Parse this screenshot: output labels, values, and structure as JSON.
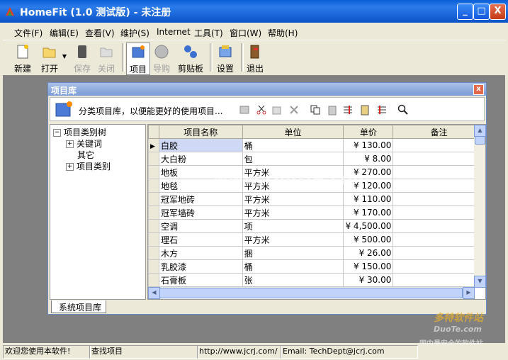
{
  "window": {
    "title": "HomeFit (1.0 测试版) - 未注册",
    "minimize": "_",
    "maximize": "□",
    "close": "X"
  },
  "menu": [
    "文件(F)",
    "编辑(E)",
    "查看(V)",
    "维护(S)",
    "Internet",
    "工具(T)",
    "窗口(W)",
    "帮助(H)"
  ],
  "toolbar": {
    "new": "新建",
    "open": "打开",
    "save": "保存",
    "close": "关闭",
    "item": "项目",
    "guide": "导购",
    "clipboard": "剪贴板",
    "settings": "设置",
    "exit": "退出"
  },
  "panel": {
    "title": "项目库",
    "close": "x",
    "hint": "分类项目库，以便能更好的使用项目...",
    "tab": "系统项目库"
  },
  "tree": {
    "root": "项目类别树",
    "children": [
      "关键词",
      "其它",
      "项目类别"
    ]
  },
  "grid": {
    "columns": [
      "项目名称",
      "单位",
      "单价",
      "备注"
    ],
    "rows": [
      {
        "name": "白胶",
        "unit": "桶",
        "price": "¥ 130.00",
        "note": ""
      },
      {
        "name": "大白粉",
        "unit": "包",
        "price": "¥ 8.00",
        "note": ""
      },
      {
        "name": "地板",
        "unit": "平方米",
        "price": "¥ 270.00",
        "note": ""
      },
      {
        "name": "地毯",
        "unit": "平方米",
        "price": "¥ 120.00",
        "note": ""
      },
      {
        "name": "冠军地砖",
        "unit": "平方米",
        "price": "¥ 110.00",
        "note": ""
      },
      {
        "name": "冠军墙砖",
        "unit": "平方米",
        "price": "¥ 170.00",
        "note": ""
      },
      {
        "name": "空调",
        "unit": "项",
        "price": "¥ 4,500.00",
        "note": ""
      },
      {
        "name": "理石",
        "unit": "平方米",
        "price": "¥ 500.00",
        "note": ""
      },
      {
        "name": "木方",
        "unit": "捆",
        "price": "¥ 26.00",
        "note": ""
      },
      {
        "name": "乳胶漆",
        "unit": "桶",
        "price": "¥ 150.00",
        "note": ""
      },
      {
        "name": "石膏板",
        "unit": "张",
        "price": "¥ 30.00",
        "note": ""
      }
    ]
  },
  "status": {
    "welcome": "欢迎您使用本软件!",
    "find": "查找项目",
    "url": "http://www.jcrj.com/",
    "email": "Email: TechDept@jcrj.com"
  },
  "watermark": {
    "center": "www.DuoTe.com",
    "corner1": "多特软件站",
    "corner2": "DuoTe.com",
    "corner3": "国内最安全的软件站"
  },
  "colors": {
    "titlebar": "#0a5fd8",
    "selection": "#cfd8f5",
    "desktop": "#808080"
  }
}
